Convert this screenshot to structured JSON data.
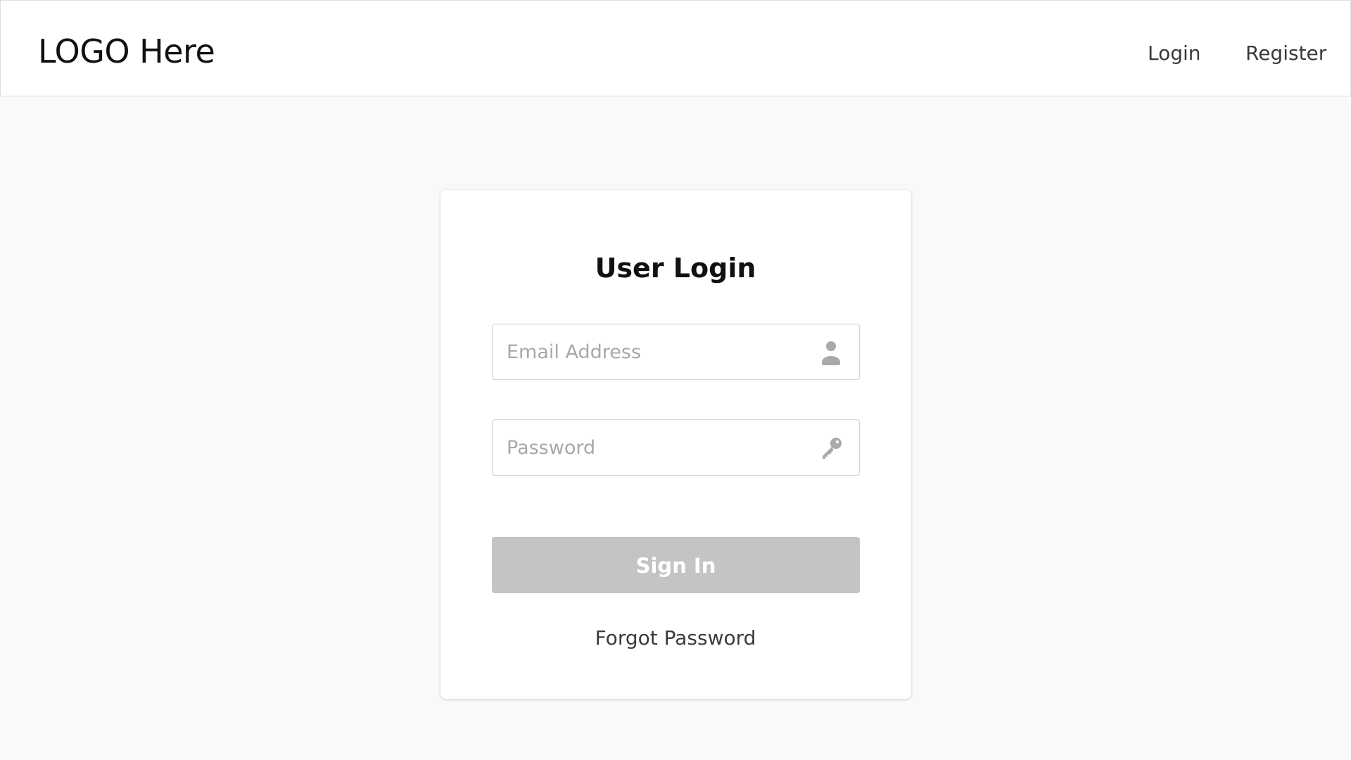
{
  "header": {
    "logo_text": "LOGO Here",
    "nav": {
      "login_label": "Login",
      "register_label": "Register"
    }
  },
  "login_form": {
    "title": "User Login",
    "email": {
      "placeholder": "Email Address",
      "value": "",
      "icon": "user-icon"
    },
    "password": {
      "placeholder": "Password",
      "value": "",
      "icon": "key-icon"
    },
    "submit_label": "Sign In",
    "forgot_password_label": "Forgot Password"
  },
  "colors": {
    "page_background": "#f9f9f9",
    "card_background": "#ffffff",
    "button_disabled": "#c4c4c4",
    "icon_gray": "#a9a9a9",
    "text_dark": "#111111",
    "text_muted": "#3a3a3a"
  }
}
